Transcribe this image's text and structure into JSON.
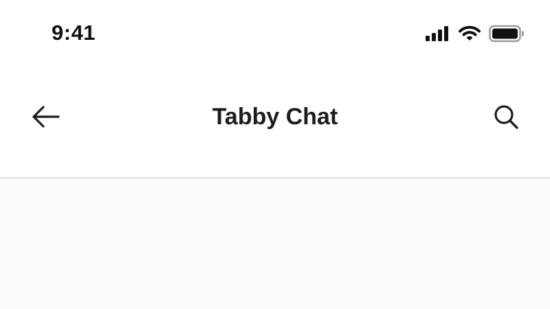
{
  "status_bar": {
    "time": "9:41",
    "icons": [
      "cellular-signal-icon",
      "wifi-icon",
      "battery-icon"
    ]
  },
  "nav_bar": {
    "title": "Tabby Chat",
    "left_icon": "back-arrow-icon",
    "right_icon": "search-icon"
  },
  "colors": {
    "background": "#ffffff",
    "content_background": "#fdfbfd",
    "divider": "#e3e3e6",
    "text": "#1d1d20"
  }
}
